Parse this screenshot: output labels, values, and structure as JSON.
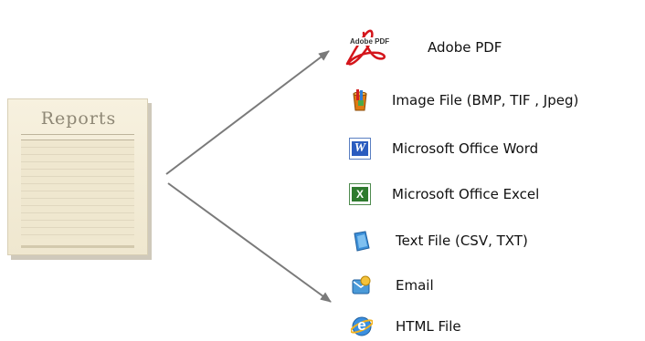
{
  "source": {
    "title": "Reports"
  },
  "targets": [
    {
      "label": "Adobe PDF",
      "icon": "adobe-pdf-icon",
      "logo_text": "Adobe PDF"
    },
    {
      "label": "Image File (BMP, TIF , Jpeg)",
      "icon": "image-file-icon"
    },
    {
      "label": "Microsoft Office Word",
      "icon": "word-icon",
      "glyph": "W"
    },
    {
      "label": "Microsoft Office Excel",
      "icon": "excel-icon",
      "glyph": "X"
    },
    {
      "label": "Text File (CSV, TXT)",
      "icon": "text-file-icon"
    },
    {
      "label": "Email",
      "icon": "email-icon"
    },
    {
      "label": "HTML File",
      "icon": "html-file-icon",
      "glyph": "e"
    }
  ],
  "colors": {
    "arrow": "#7a7a7a",
    "pdf_red": "#d4151b"
  }
}
